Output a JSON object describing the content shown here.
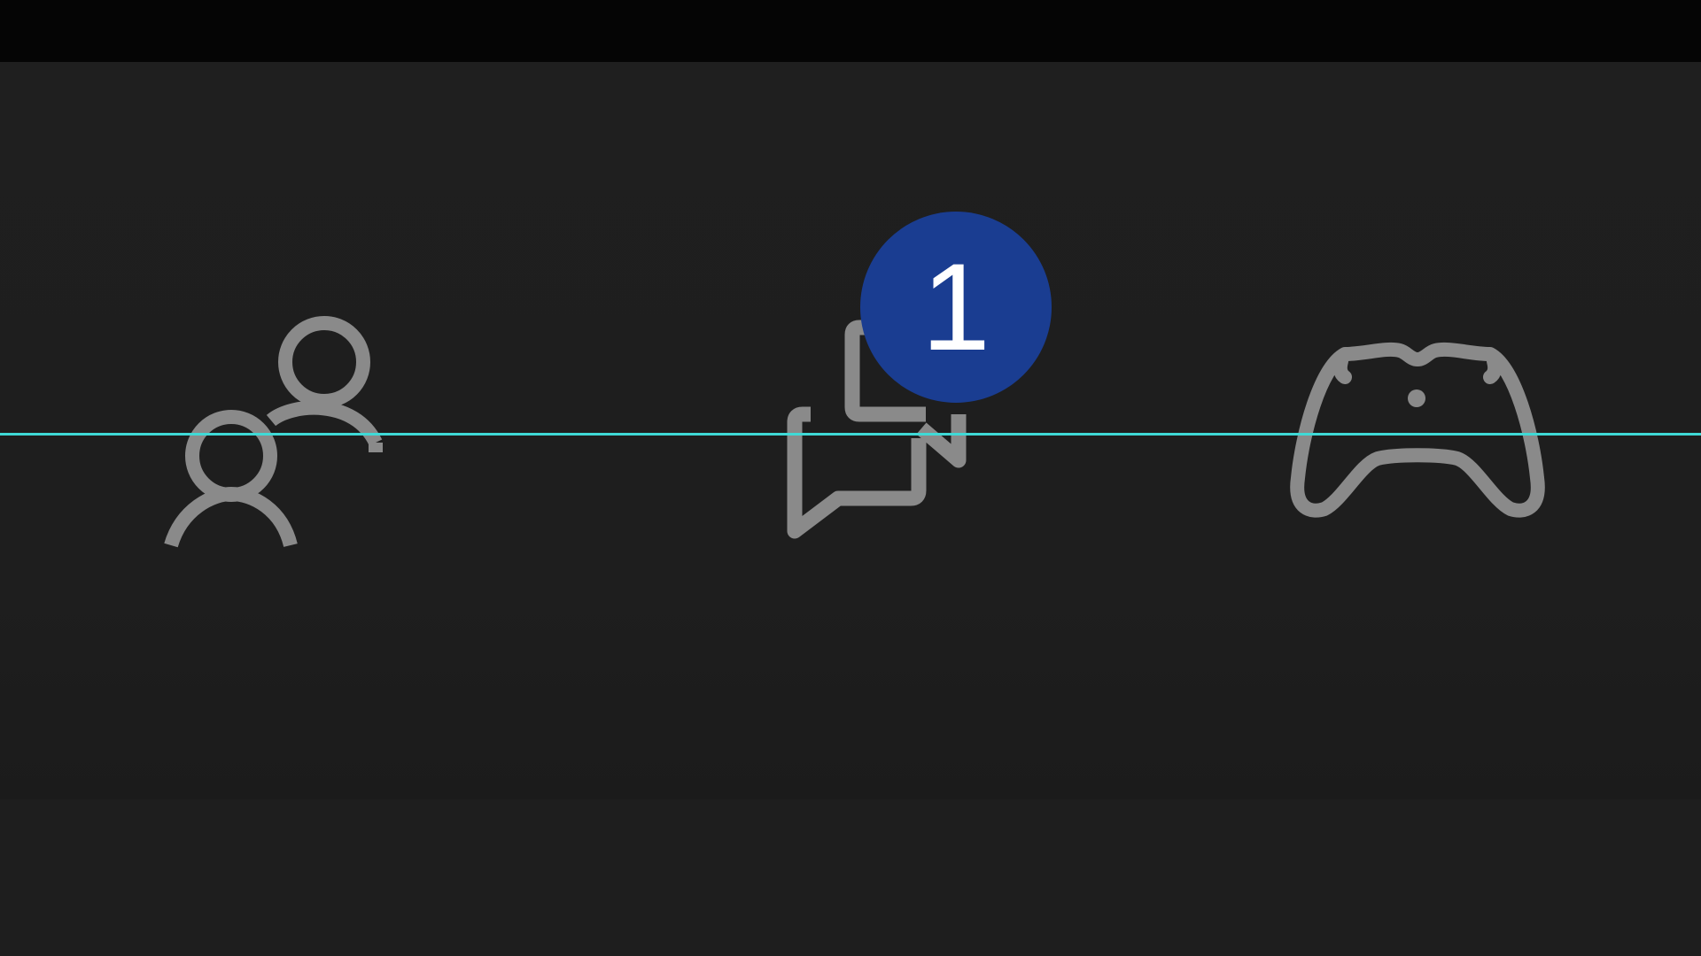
{
  "colors": {
    "top_bar": "#050505",
    "nav_background": "#1e1e1e",
    "icon_stroke": "#8a8a8a",
    "badge_fill": "#1a3d91",
    "badge_text": "#ffffff",
    "guide_line": "#3fd9d6"
  },
  "nav": {
    "items": [
      {
        "id": "friends",
        "icon": "people-icon"
      },
      {
        "id": "chat",
        "icon": "chat-bubbles-icon",
        "badge": "1"
      },
      {
        "id": "games",
        "icon": "game-controller-icon"
      }
    ]
  }
}
